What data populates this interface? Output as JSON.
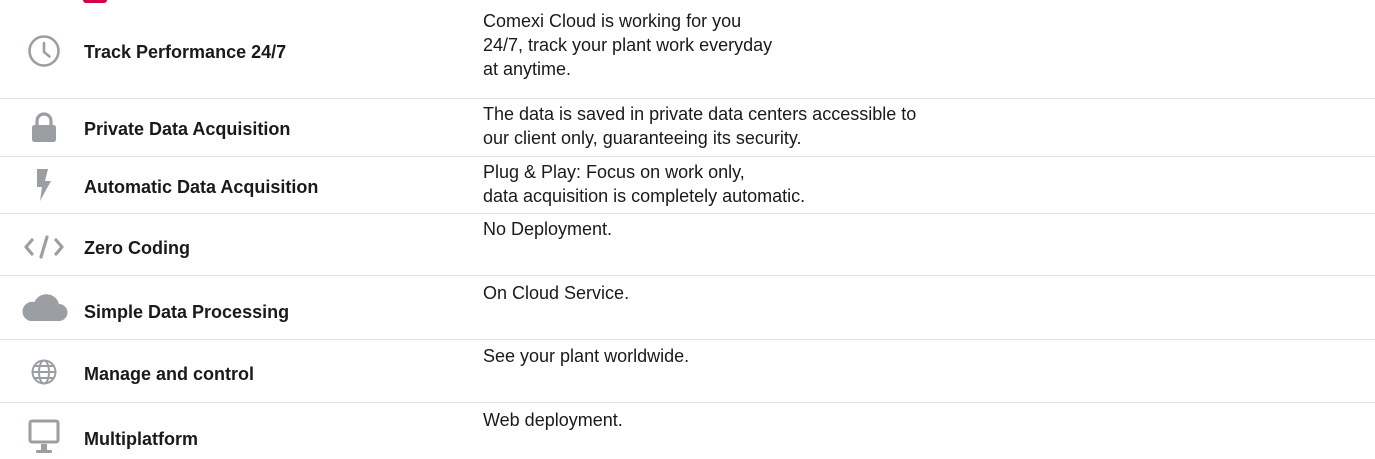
{
  "brand_color": "#d6004b",
  "icon_color": "#9b9fa3",
  "features": [
    {
      "icon": "clock-icon",
      "title": "Track Performance 24/7",
      "description": [
        "Comexi Cloud is working for you",
        "24/7, track your plant work everyday",
        "at anytime."
      ]
    },
    {
      "icon": "lock-icon",
      "title": "Private Data Acquisition",
      "description": [
        "The data is saved in private data centers accessible to",
        "our client only, guaranteeing its security."
      ]
    },
    {
      "icon": "bolt-icon",
      "title": "Automatic Data Acquisition",
      "description": [
        "Plug & Play: Focus on work only,",
        "data acquisition is completely automatic."
      ]
    },
    {
      "icon": "code-icon",
      "title": "Zero Coding",
      "description": [
        "No Deployment."
      ]
    },
    {
      "icon": "cloud-icon",
      "title": "Simple Data Processing",
      "description": [
        "On Cloud Service."
      ]
    },
    {
      "icon": "globe-icon",
      "title": "Manage and control",
      "description": [
        "See your plant worldwide."
      ]
    },
    {
      "icon": "monitor-icon",
      "title": "Multiplatform",
      "description": [
        "Web deployment."
      ]
    }
  ]
}
